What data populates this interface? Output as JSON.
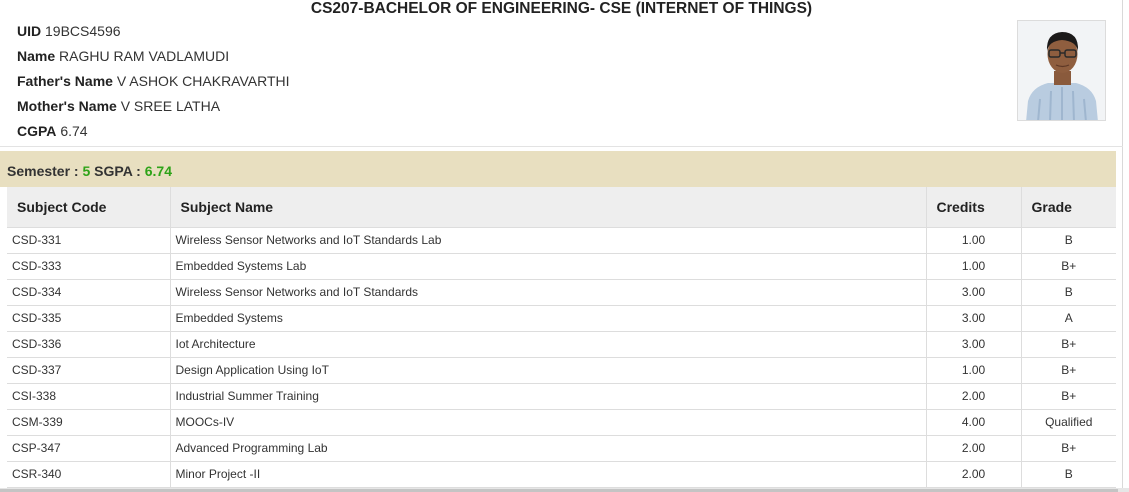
{
  "title": "CS207-BACHELOR OF ENGINEERING- CSE (INTERNET OF THINGS)",
  "student": {
    "uid_label": "UID",
    "uid": "19BCS4596",
    "name_label": "Name",
    "name": "RAGHU RAM VADLAMUDI",
    "father_label": "Father's Name",
    "father": "V ASHOK CHAKRAVARTHI",
    "mother_label": "Mother's Name",
    "mother": "V SREE LATHA",
    "cgpa_label": "CGPA",
    "cgpa": "6.74"
  },
  "semester": {
    "sem_label": "Semester :",
    "sem_value": "5",
    "sgpa_label": "SGPA :",
    "sgpa_value": "6.74"
  },
  "table": {
    "headers": [
      "Subject Code",
      "Subject Name",
      "Credits",
      "Grade"
    ],
    "rows": [
      [
        "CSD-331",
        "Wireless Sensor Networks and IoT Standards Lab",
        "1.00",
        "B"
      ],
      [
        "CSD-333",
        "Embedded Systems Lab",
        "1.00",
        "B+"
      ],
      [
        "CSD-334",
        "Wireless Sensor Networks and IoT Standards",
        "3.00",
        "B"
      ],
      [
        "CSD-335",
        "Embedded Systems",
        "3.00",
        "A"
      ],
      [
        "CSD-336",
        "Iot Architecture",
        "3.00",
        "B+"
      ],
      [
        "CSD-337",
        "Design Application Using IoT",
        "1.00",
        "B+"
      ],
      [
        "CSI-338",
        "Industrial Summer Training",
        "2.00",
        "B+"
      ],
      [
        "CSM-339",
        "MOOCs-IV",
        "4.00",
        "Qualified"
      ],
      [
        "CSP-347",
        "Advanced Programming Lab",
        "2.00",
        "B+"
      ],
      [
        "CSR-340",
        "Minor Project -II",
        "2.00",
        "B"
      ]
    ]
  },
  "colors": {
    "semester_bar": "#e8dfc0",
    "accent_green": "#2ea318",
    "header_bg": "#eeeeee"
  }
}
